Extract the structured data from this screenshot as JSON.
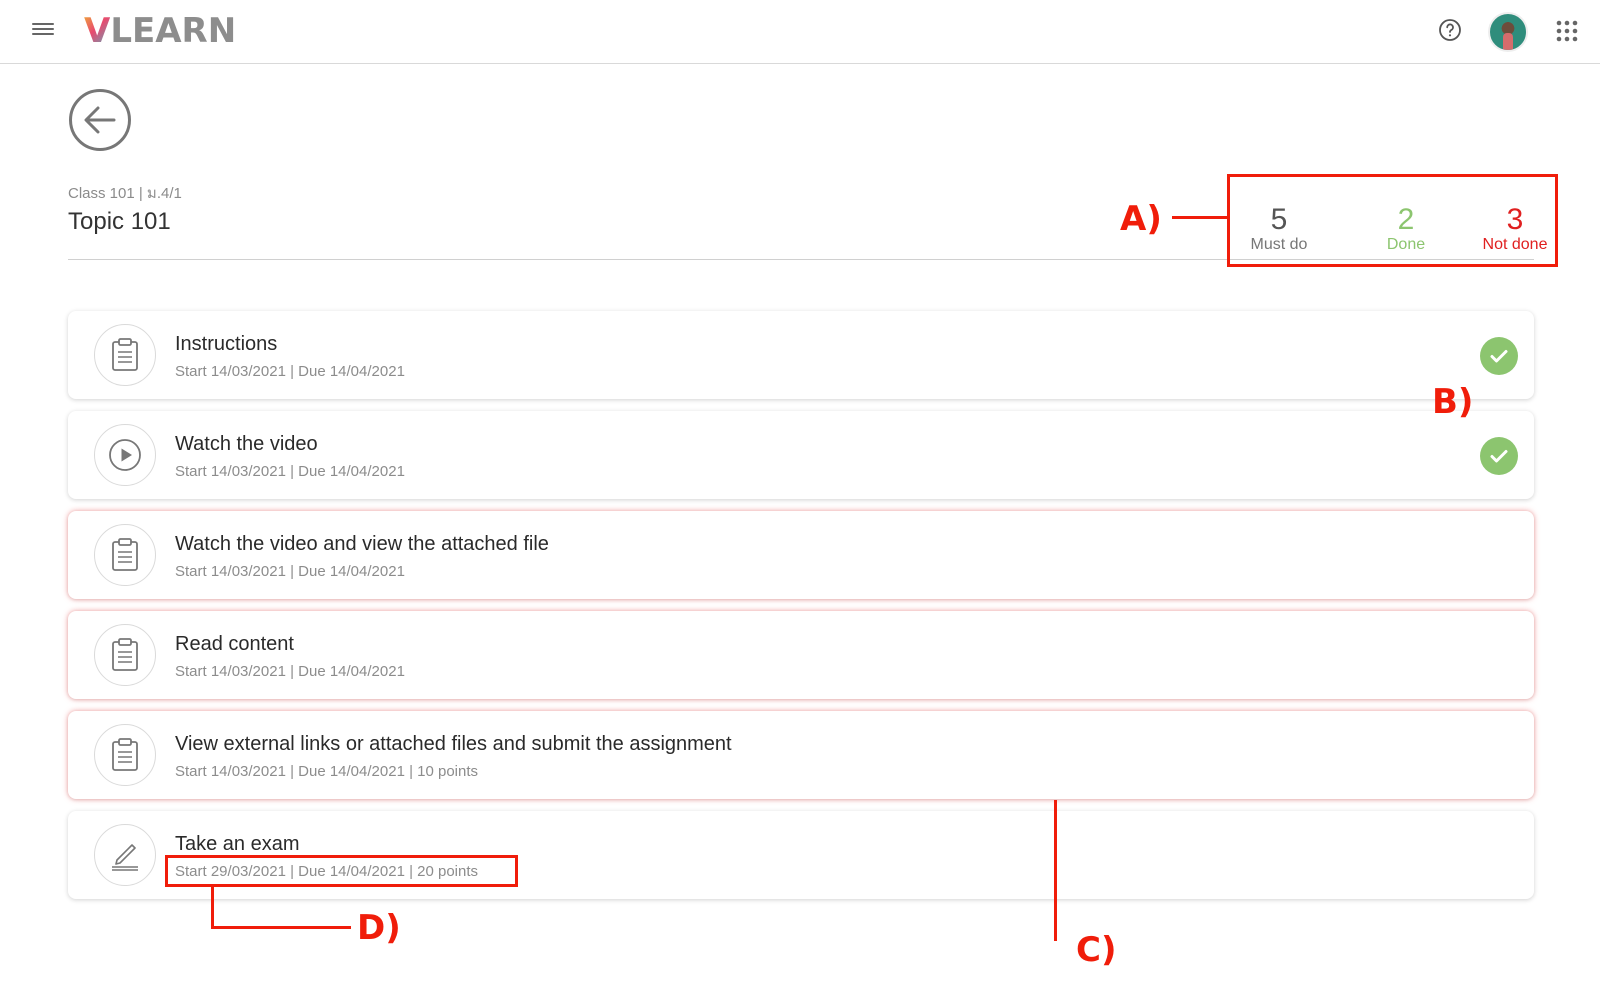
{
  "header": {
    "logo_v": "V",
    "logo_rest": "LEARN"
  },
  "course": {
    "subtitle": "Class 101 | ม.4/1",
    "title": "Topic 101"
  },
  "stats": {
    "must_do": {
      "value": "5",
      "label": "Must do"
    },
    "done": {
      "value": "2",
      "label": "Done"
    },
    "not_done": {
      "value": "3",
      "label": "Not done"
    }
  },
  "activities": [
    {
      "title": "Instructions",
      "meta": "Start 14/03/2021 | Due 14/04/2021",
      "icon": "clipboard-icon",
      "completed": true
    },
    {
      "title": "Watch the video",
      "meta": "Start 14/03/2021 | Due 14/04/2021",
      "icon": "play-icon",
      "completed": true
    },
    {
      "title": "Watch the video and view the attached file",
      "meta": "Start 14/03/2021 | Due 14/04/2021",
      "icon": "clipboard-icon",
      "completed": false
    },
    {
      "title": "Read content",
      "meta": "Start 14/03/2021 | Due 14/04/2021",
      "icon": "clipboard-icon",
      "completed": false
    },
    {
      "title": "View external links or attached files and submit the assignment",
      "meta": "Start 14/03/2021 | Due 14/04/2021 | 10 points",
      "icon": "clipboard-icon",
      "completed": false
    },
    {
      "title": "Take an exam",
      "meta": "Start 29/03/2021 | Due 14/04/2021 | 20 points",
      "icon": "pen-icon",
      "completed": false
    }
  ],
  "annotations": {
    "a": "A)",
    "b": "B)",
    "c": "C)",
    "d": "D)"
  },
  "colors": {
    "done": "#8cc56f",
    "not_done": "#e02020",
    "annotation": "#f01d0a"
  }
}
